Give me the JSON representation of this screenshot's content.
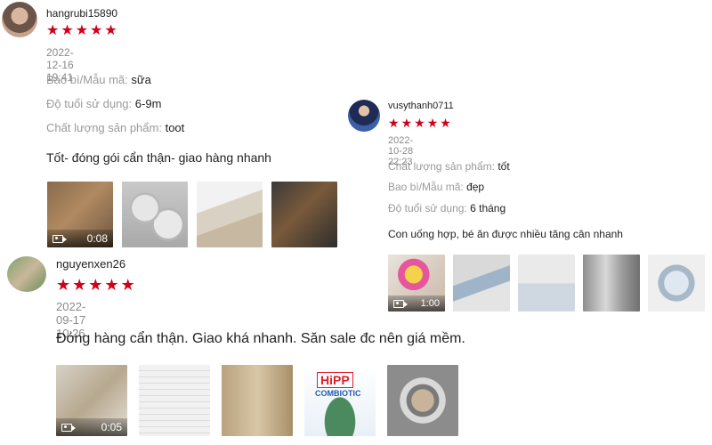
{
  "reviews": [
    {
      "username": "hangrubi15890",
      "rating": 5,
      "datetime": "2022-12-16 19:41",
      "attributes": [
        {
          "label": "Bao bì/Mẫu mã:",
          "value": "sữa"
        },
        {
          "label": "Độ tuổi sử dụng:",
          "value": "6-9m"
        },
        {
          "label": "Chất lượng sản phẩm:",
          "value": "toot"
        }
      ],
      "comment": "Tốt- đóng gói cẩn thận- giao hàng nhanh",
      "video_duration": "0:08"
    },
    {
      "username": "vusythanh0711",
      "rating": 5,
      "datetime": "2022-10-28 22:23",
      "attributes": [
        {
          "label": "Chất lượng sản phẩm:",
          "value": "tốt"
        },
        {
          "label": "Bao bì/Mẫu mã:",
          "value": "đẹp"
        },
        {
          "label": "Độ tuổi sử dụng:",
          "value": "6 tháng"
        }
      ],
      "comment": "Con uống hợp, bé ăn được nhiều tăng cân nhanh",
      "video_duration": "1:00"
    },
    {
      "username": "nguyenxen26",
      "rating": 5,
      "datetime": "2022-09-17 10:26",
      "attributes": [],
      "comment": "Đóng hàng cẩn thận. Giao khá nhanh. Săn sale đc nên giá mềm.",
      "video_duration": "0:05",
      "product_brand": "HiPP",
      "product_line": "COMBIOTIC"
    }
  ],
  "colors": {
    "star": "#d0021b",
    "muted_text": "#9a9a9a",
    "date_text": "#8a8a8a"
  }
}
